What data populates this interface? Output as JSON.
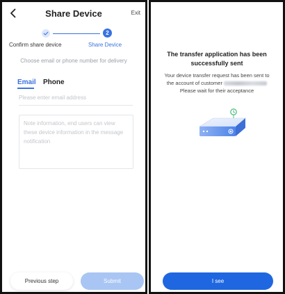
{
  "share_screen": {
    "header": {
      "title": "Share Device",
      "exit_label": "Exit"
    },
    "stepper": {
      "step1_label": "Confirm share device",
      "step2_number": "2",
      "step2_label": "Share Device"
    },
    "hint": "Choose email or phone number for delivery",
    "tabs": {
      "email": "Email",
      "phone": "Phone",
      "active": "email"
    },
    "email_input": {
      "value": "",
      "placeholder": "Please enter email address"
    },
    "note_input": {
      "value": "",
      "placeholder": "Note information, end users can view these device information in the message notification"
    },
    "buttons": {
      "previous": "Previous step",
      "submit": "Submit"
    }
  },
  "success_screen": {
    "title": "The transfer application has been successfully sent",
    "message_line1": "Your device transfer request has been sent to",
    "message_line2_prefix": "the account of customer",
    "message_line3": "Please wait for their acceptance",
    "button": "I see"
  },
  "colors": {
    "accent": "#3a72e0",
    "primary_button": "#1f67e0",
    "submit_disabled": "#a9c5f3",
    "hint_text": "#9aa0a8",
    "success_green": "#34b36b"
  },
  "icons": [
    "back-arrow-icon",
    "check-icon",
    "device-router-icon",
    "clock-icon"
  ]
}
